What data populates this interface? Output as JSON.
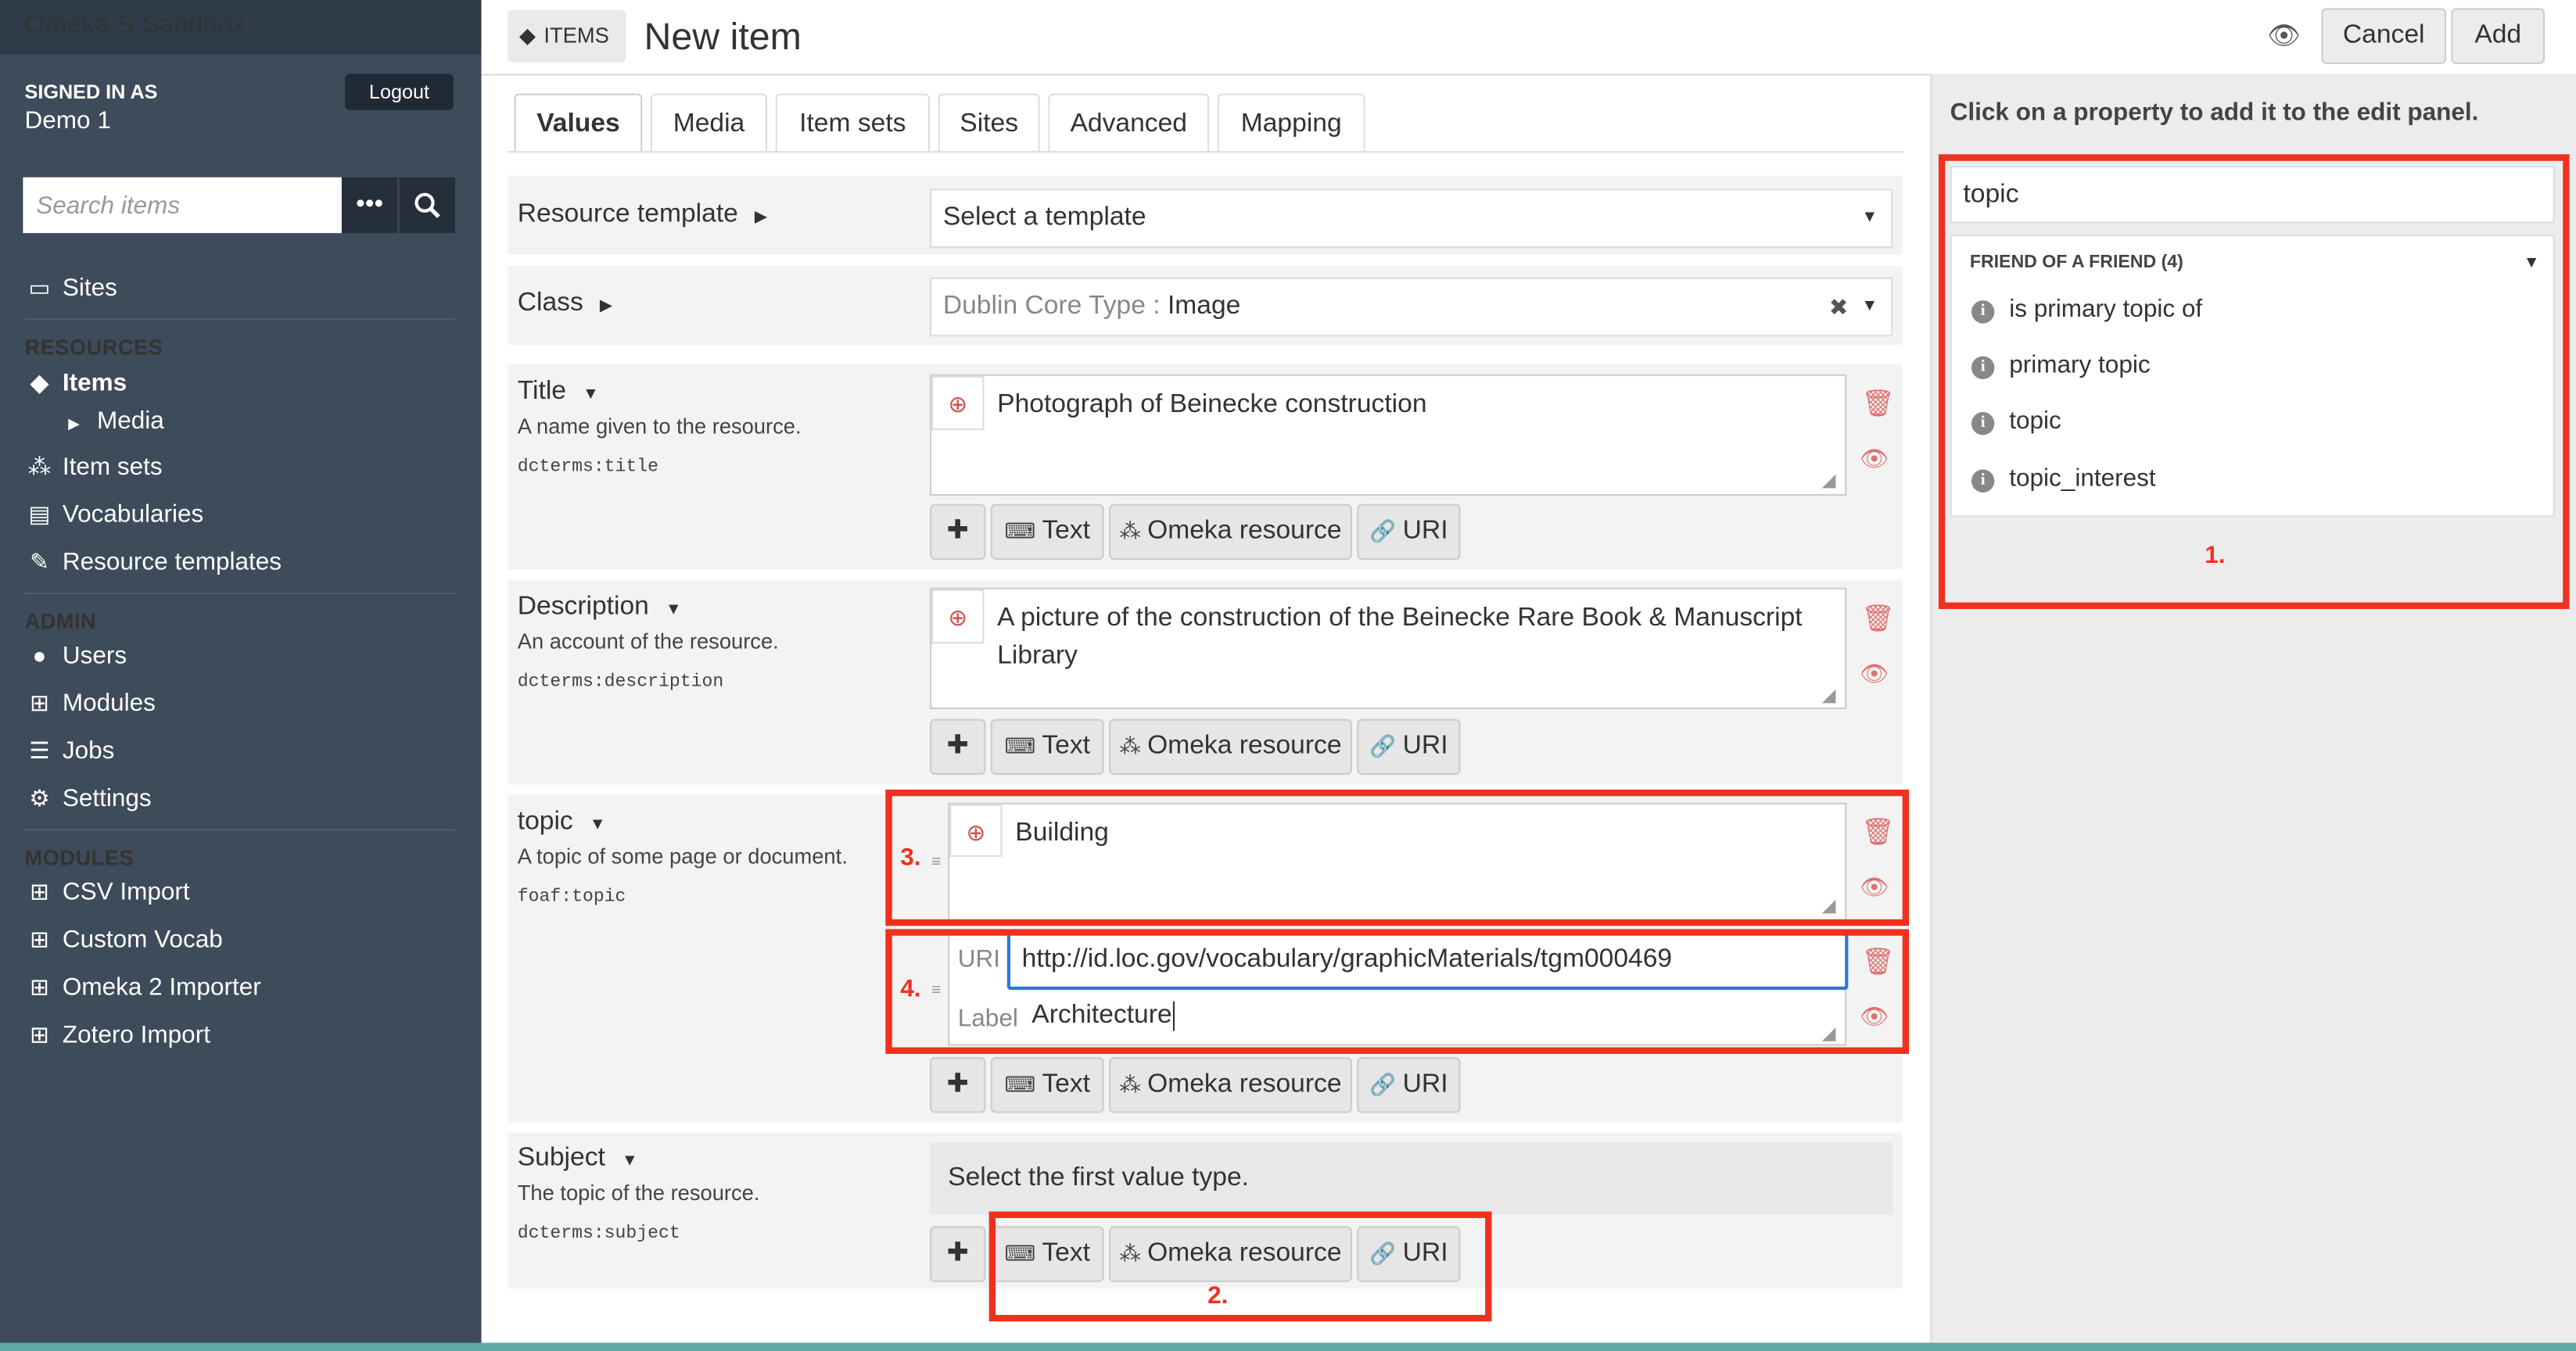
{
  "sidebar": {
    "brand": "Omeka S Sandbox",
    "signed_in_as": "SIGNED IN AS",
    "user": "Demo 1",
    "logout": "Logout",
    "search_placeholder": "Search items",
    "nav": {
      "sites": "Sites",
      "resources_heading": "RESOURCES",
      "items": "Items",
      "media": "Media",
      "item_sets": "Item sets",
      "vocabularies": "Vocabularies",
      "resource_templates": "Resource templates",
      "admin_heading": "ADMIN",
      "users": "Users",
      "modules": "Modules",
      "jobs": "Jobs",
      "settings": "Settings",
      "modules_heading": "MODULES",
      "csv_import": "CSV Import",
      "custom_vocab": "Custom Vocab",
      "omeka2_importer": "Omeka 2 Importer",
      "zotero_import": "Zotero Import"
    }
  },
  "header": {
    "section": "ITEMS",
    "title": "New item",
    "cancel": "Cancel",
    "add": "Add"
  },
  "tabs": [
    "Values",
    "Media",
    "Item sets",
    "Sites",
    "Advanced",
    "Mapping"
  ],
  "resource_template": {
    "label": "Resource template",
    "select_value": "Select a template"
  },
  "class": {
    "label": "Class",
    "prefix": "Dublin Core Type",
    "value": "Image"
  },
  "properties": {
    "title": {
      "label": "Title",
      "description": "A name given to the resource.",
      "term": "dcterms:title",
      "value": "Photograph of Beinecke construction"
    },
    "description": {
      "label": "Description",
      "description": "An account of the resource.",
      "term": "dcterms:description",
      "value": "A picture of the construction of the Beinecke Rare Book & Manuscript Library"
    },
    "topic": {
      "label": "topic",
      "description": "A topic of some page or document.",
      "term": "foaf:topic",
      "value_text": "Building",
      "uri_label": "URI",
      "uri_value": "http://id.loc.gov/vocabulary/graphicMaterials/tgm000469",
      "label_label": "Label",
      "label_value": "Architecture"
    },
    "subject": {
      "label": "Subject",
      "description": "The topic of the resource.",
      "term": "dcterms:subject",
      "hint": "Select the first value type."
    }
  },
  "value_buttons": {
    "text": "Text",
    "omeka_resource": "Omeka resource",
    "uri": "URI"
  },
  "right_panel": {
    "heading": "Click on a property to add it to the edit panel.",
    "search_value": "topic",
    "group": "FRIEND OF A FRIEND (4)",
    "items": [
      "is primary topic of",
      "primary topic",
      "topic",
      "topic_interest"
    ]
  },
  "annotations": {
    "one": "1.",
    "two": "2.",
    "three": "3.",
    "four": "4."
  },
  "colors": {
    "sidebar_bg": "#3d4b5a",
    "annotation_red": "#f0301e",
    "uri_focus_blue": "#2a79d8"
  }
}
